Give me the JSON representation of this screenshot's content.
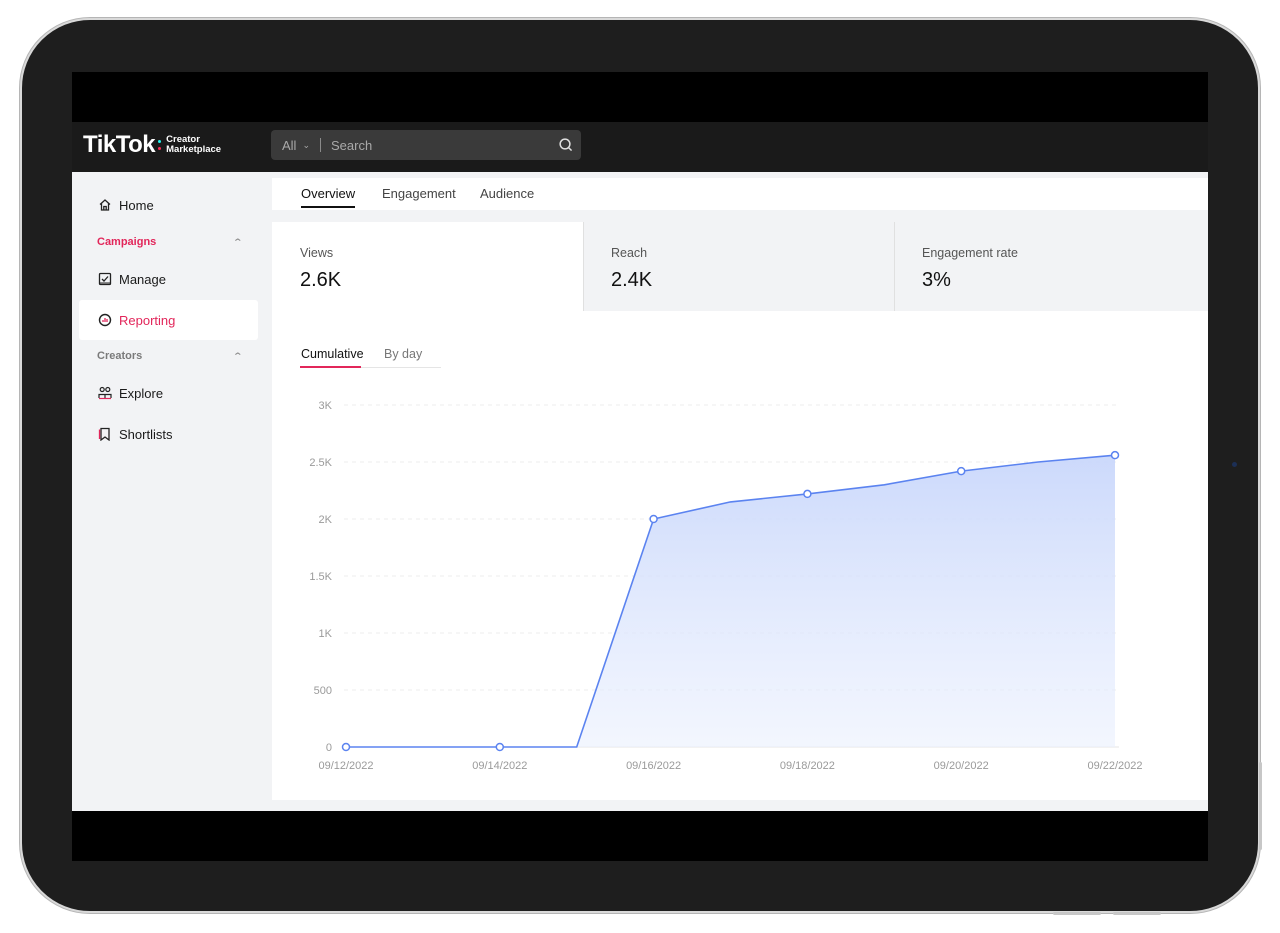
{
  "app": {
    "logo_main": "TikTok",
    "logo_sub_line1": "Creator",
    "logo_sub_line2": "Marketplace"
  },
  "search": {
    "scope": "All",
    "placeholder": "Search"
  },
  "sidebar": {
    "home": "Home",
    "campaigns_group": "Campaigns",
    "manage": "Manage",
    "reporting": "Reporting",
    "creators_group": "Creators",
    "explore": "Explore",
    "shortlists": "Shortlists"
  },
  "tabs": [
    "Overview",
    "Engagement",
    "Audience"
  ],
  "stats": [
    {
      "label": "Views",
      "value": "2.6K"
    },
    {
      "label": "Reach",
      "value": "2.4K"
    },
    {
      "label": "Engagement rate",
      "value": "3%"
    }
  ],
  "subtabs": [
    "Cumulative",
    "By day"
  ],
  "colors": {
    "accent": "#e2265a",
    "line": "#5b83f0",
    "area_top": "#c9d7fb"
  },
  "chart_data": {
    "type": "area",
    "x": [
      "09/12/2022",
      "09/13/2022",
      "09/14/2022",
      "09/15/2022",
      "09/16/2022",
      "09/17/2022",
      "09/18/2022",
      "09/19/2022",
      "09/20/2022",
      "09/21/2022",
      "09/22/2022"
    ],
    "values": [
      0,
      0,
      0,
      0,
      2000,
      2150,
      2220,
      2300,
      2420,
      2500,
      2560
    ],
    "markers": [
      "09/12/2022",
      "09/14/2022",
      "09/16/2022",
      "09/18/2022",
      "09/20/2022",
      "09/22/2022"
    ],
    "xticks": [
      "09/12/2022",
      "09/14/2022",
      "09/16/2022",
      "09/18/2022",
      "09/20/2022",
      "09/22/2022"
    ],
    "yticks": [
      0,
      500,
      1000,
      1500,
      2000,
      2500,
      3000
    ],
    "ytick_labels": [
      "0",
      "500",
      "1K",
      "1.5K",
      "2K",
      "2.5K",
      "3K"
    ],
    "ylim": [
      0,
      3000
    ],
    "grid": true
  }
}
